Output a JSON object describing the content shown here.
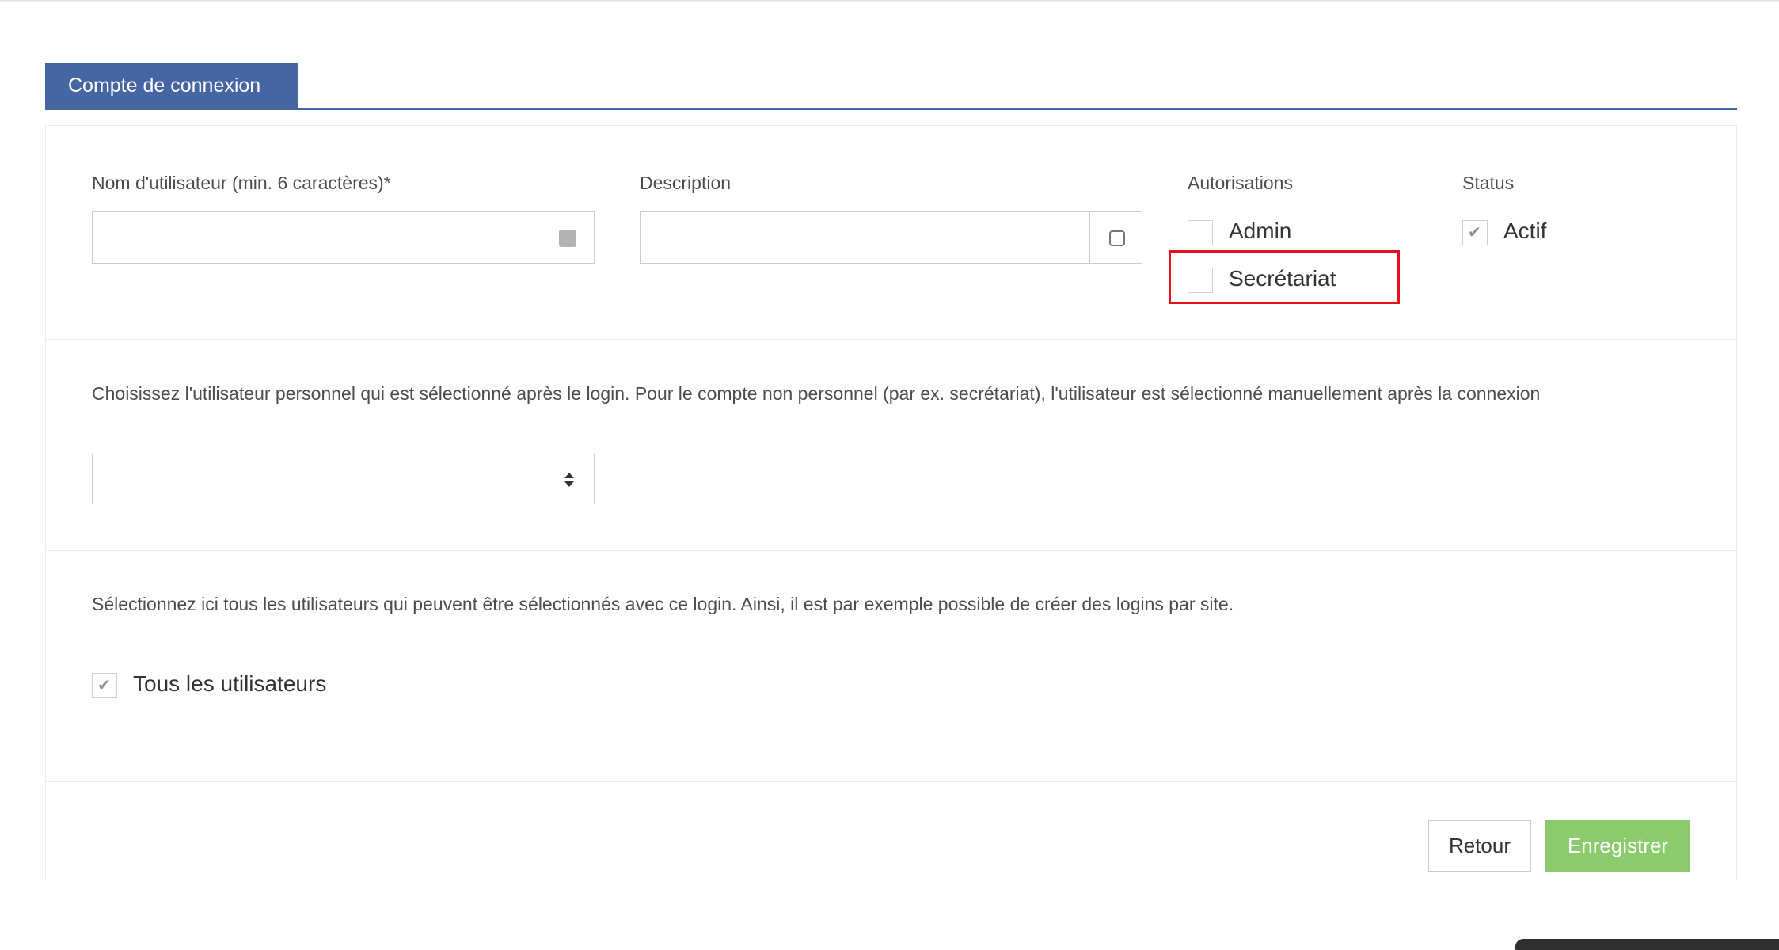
{
  "tab": {
    "label": "Compte de connexion"
  },
  "form": {
    "username": {
      "label": "Nom d'utilisateur (min. 6 caractères)*",
      "value": "",
      "placeholder": ""
    },
    "description": {
      "label": "Description",
      "value": "",
      "placeholder": ""
    },
    "permissions": {
      "label": "Autorisations",
      "options": [
        {
          "label": "Admin",
          "checked": false
        },
        {
          "label": "Secrétariat",
          "checked": false
        }
      ]
    },
    "status": {
      "label": "Status",
      "option": {
        "label": "Actif",
        "checked": true
      }
    }
  },
  "personal_user": {
    "instruction": "Choisissez l'utilisateur personnel qui est sélectionné après le login. Pour le compte non personnel (par ex. secrétariat), l'utilisateur est sélectionné manuellement après la connexion",
    "selected_value": ""
  },
  "selectable_users": {
    "instruction": "Sélectionnez ici tous les utilisateurs qui peuvent être sélectionnés avec ce login. Ainsi, il est par exemple possible de créer des logins par site.",
    "all_users": {
      "label": "Tous les utilisateurs",
      "checked": true
    }
  },
  "actions": {
    "back_label": "Retour",
    "save_label": "Enregistrer"
  },
  "colors": {
    "tab": "#4565a3",
    "save_button": "#8ccb6d",
    "highlight": "#e8101a"
  },
  "icons": {
    "checkmark": "check-icon",
    "select_caret": "sort-caret-icon"
  }
}
